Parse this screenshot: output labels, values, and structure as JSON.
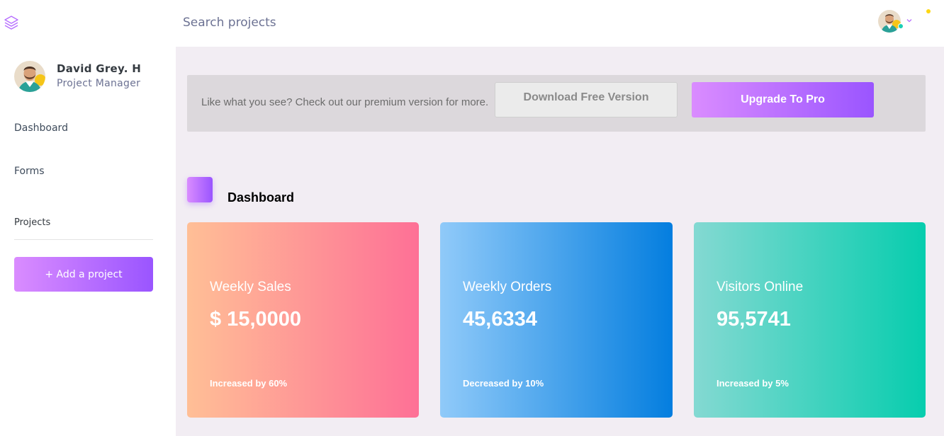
{
  "navbar": {
    "search_placeholder": "Search projects",
    "logo_icon": "layers-icon",
    "avatar_icon": "user-avatar",
    "chevron_icon": "chevron-down-icon",
    "status_color": "#1bcfb4",
    "notification_color": "#fed713"
  },
  "sidebar": {
    "profile": {
      "name": "David Grey. H",
      "role": "Project Manager"
    },
    "items": [
      {
        "label": "Dashboard"
      },
      {
        "label": "Forms"
      }
    ],
    "projects_heading": "Projects",
    "add_project_label": "+ Add a project"
  },
  "banner": {
    "text": "Like what you see? Check out our premium version for more.",
    "download_label": "Download Free Version",
    "upgrade_label": "Upgrade To Pro"
  },
  "page": {
    "title": "Dashboard"
  },
  "cards": [
    {
      "label": "Weekly Sales",
      "value": "$ 15,0000",
      "change": "Increased by 60%",
      "gradient": [
        "#ffbf96",
        "#fe7096"
      ]
    },
    {
      "label": "Weekly Orders",
      "value": "45,6334",
      "change": "Decreased by 10%",
      "gradient": [
        "#90caf9",
        "#047edf"
      ]
    },
    {
      "label": "Visitors Online",
      "value": "95,5741",
      "change": "Increased by 5%",
      "gradient": [
        "#84d9d2",
        "#07cdae"
      ]
    }
  ],
  "theme": {
    "accent_gradient": [
      "#da8cff",
      "#9a55ff"
    ],
    "background": "#f2edf3"
  }
}
